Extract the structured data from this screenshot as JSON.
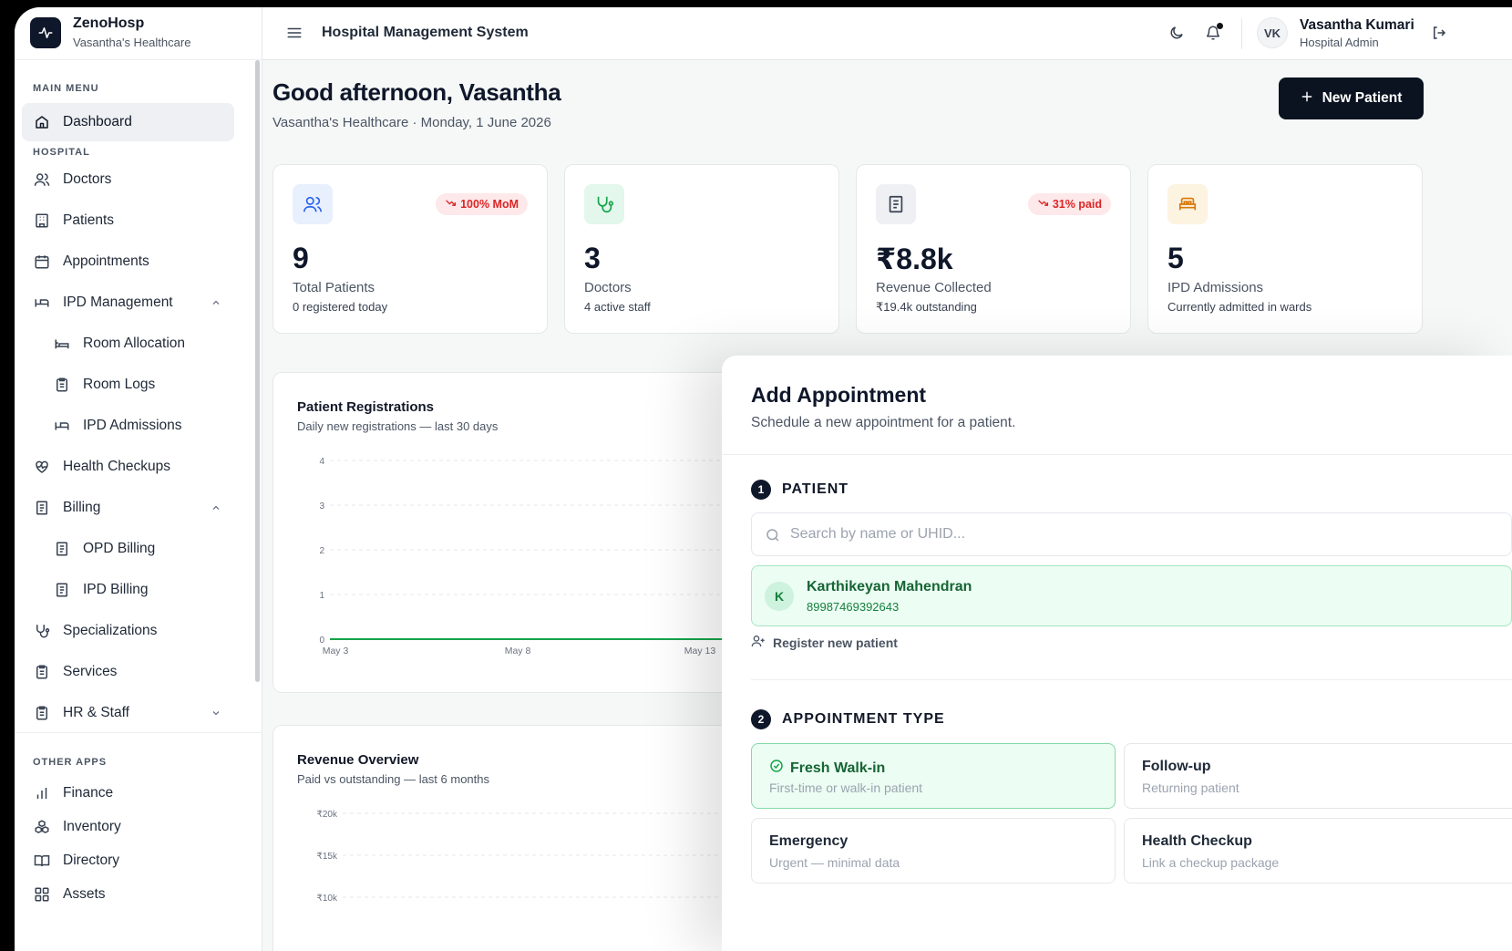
{
  "brand": {
    "name": "ZenoHosp",
    "subtitle": "Vasantha's Healthcare"
  },
  "sidebar": {
    "main_label": "MAIN MENU",
    "dashboard": "Dashboard",
    "hospital_label": "HOSPITAL",
    "items": {
      "doctors": "Doctors",
      "patients": "Patients",
      "appointments": "Appointments",
      "ipd": "IPD Management",
      "room_allocation": "Room Allocation",
      "room_logs": "Room Logs",
      "ipd_admissions": "IPD Admissions",
      "health_checkups": "Health Checkups",
      "billing": "Billing",
      "opd_billing": "OPD Billing",
      "ipd_billing": "IPD Billing",
      "specializations": "Specializations",
      "services": "Services",
      "hr_staff": "HR & Staff"
    },
    "other_label": "OTHER APPS",
    "other": {
      "finance": "Finance",
      "inventory": "Inventory",
      "directory": "Directory",
      "assets": "Assets"
    }
  },
  "header": {
    "title": "Hospital Management System",
    "user_initials": "VK",
    "user_name": "Vasantha Kumari",
    "user_role": "Hospital Admin"
  },
  "main": {
    "greeting": "Good afternoon, Vasantha",
    "subtitle": "Vasantha's Healthcare · Monday, 1 June 2026",
    "new_patient": "New Patient"
  },
  "stats": [
    {
      "value": "9",
      "label": "Total Patients",
      "sub": "0 registered today",
      "badge": "100% MoM"
    },
    {
      "value": "3",
      "label": "Doctors",
      "sub": "4 active staff"
    },
    {
      "value": "₹8.8k",
      "label": "Revenue Collected",
      "sub": "₹19.4k outstanding",
      "badge": "31% paid"
    },
    {
      "value": "5",
      "label": "IPD Admissions",
      "sub": "Currently admitted in wards"
    }
  ],
  "registrations": {
    "title": "Patient Registrations",
    "subtitle": "Daily new registrations — last 30 days"
  },
  "revenue": {
    "title": "Revenue Overview",
    "subtitle": "Paid vs outstanding — last 6 months"
  },
  "chart_data": [
    {
      "type": "line",
      "title": "Patient Registrations",
      "x": [
        "May 3",
        "May 8",
        "May 13"
      ],
      "series": [
        {
          "values": [
            0,
            0,
            0
          ]
        }
      ],
      "yticks": [
        "0",
        "1",
        "2",
        "3",
        "4"
      ],
      "ylim": [
        0,
        4
      ],
      "grid": true,
      "color": "#16a34a"
    },
    {
      "type": "bar",
      "title": "Revenue Overview",
      "yticks": [
        "₹20k",
        "₹15k",
        "₹10k"
      ],
      "grid": true
    }
  ],
  "drawer": {
    "title": "Add Appointment",
    "subtitle": "Schedule a new appointment for a patient.",
    "step1_num": "1",
    "step1": "PATIENT",
    "search_placeholder": "Search by name or UHID...",
    "patient_initial": "K",
    "patient_name": "Karthikeyan Mahendran",
    "patient_id": "89987469392643",
    "register": "Register new patient",
    "step2_num": "2",
    "step2": "APPOINTMENT TYPE",
    "types": [
      {
        "title": "Fresh Walk-in",
        "desc": "First-time or walk-in patient",
        "selected": true
      },
      {
        "title": "Follow-up",
        "desc": "Returning patient"
      },
      {
        "title": "Emergency",
        "desc": "Urgent — minimal data"
      },
      {
        "title": "Health Checkup",
        "desc": "Link a checkup package"
      }
    ]
  },
  "colors": {
    "primary": "#0b1220",
    "success": "#16a34a",
    "danger": "#dc2626"
  }
}
